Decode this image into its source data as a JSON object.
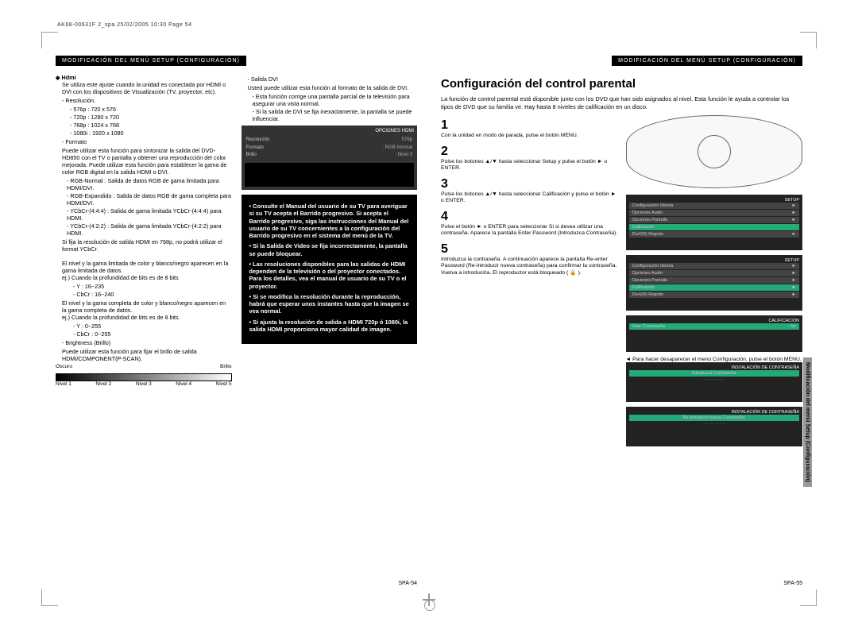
{
  "header": "AK68-00631F 2_spa  25/02/2005  10:30  Page 54",
  "section_bar": "Modificación del menú Setup (Configuración)",
  "left": {
    "hdmi": {
      "title": "Hdmi",
      "intro": "Se utiliza este ajuste cuando la unidad es conectada por HDMI o DVI con los dispositivos de Visualización (TV, proyector, etc).",
      "resolucion_label": "Resolución.",
      "res": [
        "576p : 720 x 576",
        "720p : 1280 x 720",
        "768p : 1024 x 768",
        "1080i : 1920 x 1080"
      ],
      "formato_label": "Formato",
      "formato_text": "Puede utilizar esta función para sintonizar la salida del DVD-HD850 con el TV o pantalla y obtener una reproducción del color mejorada. Puede utilizar esta función para establecer la gama de color RGB digital en la salida HDMI o DVI.",
      "rgb_normal": "RGB-Normal : Salida de datos RGB de gama limitada para HDMI/DVI.",
      "rgb_exp": "RGB-Expandido : Salida de datos RGB de gama completa para HDMI/DVI.",
      "yc444": "YCbCr-(4:4:4) : Salida de gama limitada YCbCr-(4:4:4) para HDMI.",
      "yc422": "YCbCr-(4:2:2) : Salida de gama limitada YCbCr-(4:2:2) para HDMI.",
      "note768": "Si fija la resolución de salida HDMI en 768p, no podrá utilizar el format YCbCr.",
      "gamma_lim": "El nivel y la gama limitada de color y blanco/negro aparecen en la gama limitada de datos.",
      "ej8a": "ej.) Cuando la profundidad de bits es de 8 bits",
      "y235": "Y : 16~235",
      "cb240": "CbCr : 16~240",
      "gamma_full": "El nivel y la gama completa de color y blanco/negro aparecen en la gama completa de datos.",
      "ej8b": "ej.) Cuando la profundidad de bits es de 8 bits.",
      "y255": "Y : 0~255",
      "cb255": "CbCr : 0~255",
      "brightness_label": "Brightness (Brillo)",
      "brightness_text": "Puede utilizar esta función para fijar el brillo de salida HDMI/COMPONENT(P-SCAN).",
      "oscuro": "Oscuro",
      "brillo": "Brillo",
      "levels": [
        "Nivel 1",
        "Nivel 2",
        "Nivel 3",
        "Nivel 4",
        "Nivel 5"
      ]
    },
    "dvi": {
      "label": "Salida DVI",
      "text": "Usted puede utilizar esta función al formato de la salida de DVI.",
      "b1": "Esta función corrige una pantalla parcial de la televisión para asegurar una vista normal.",
      "b2": "Si la salida de DVI se fija inexactamente, la pantalla se puede influenciar."
    },
    "osd": {
      "title": "OPCIONES HDMI",
      "rows": [
        [
          "Resolución",
          ": 576p"
        ],
        [
          "Formato",
          ": RGB-Normal"
        ],
        [
          "Brillo",
          ": Nivel 3"
        ]
      ]
    },
    "black_box": [
      "• Consulte el Manual del usuario de su TV para averiguar si su TV acepta el Barrido progresivo. Si acepta el Barrido progresivo, siga las instrucciones del Manual del usuario de su TV concernientes a la configuración del Barrido progresivo en el sistema del menú de la TV.",
      "• Si la Salida de Video se fija incorrectamente, la pantalla se puede bloquear.",
      "• Las resoluciones disponibles para las salidas de HDMI dependen de la televisión o del proyector conectados. Para los detalles, vea el manual de usuario de su TV o el proyector.",
      "• Si se modifica la resolución durante la reproducción, habrá que esperar unos instantes hasta que la imagen se vea normal.",
      "• Si ajusta la resolución de salida a HDMI 720p ó 1080i, la salida HDMI proporciona mayor calidad de imagen."
    ],
    "page_num": "SPA-54"
  },
  "right": {
    "title": "Configuración del control parental",
    "intro": "La función de control parental está disponible junto con los DVD que han sido asignados al nivel. Esta función le ayuda a controlar los tipos de DVD que su familia ve. Hay hasta 8 niveles de calificación en un disco.",
    "steps": {
      "s1": "Con la unidad en modo de parada, pulse el botón MENU.",
      "s2": "Pulse los botones ▲/▼ hasta seleccionar Setup y pulse el botón ► o ENTER.",
      "s3": "Pulse los botones ▲/▼ hasta seleccionar Calificación y pulse el botón ► o ENTER.",
      "s4": "Pulse el botón ► o ENTER para seleccionar Si si desea utilizar una contraseña. Aparece la pantalla Enter Password (Introduzca Contraseña).",
      "s5": "Introduzca la contraseña. A continuación aparece la pantalla Re-enter Password (Re-introducir nueva contraseña) para confirmar la contraseña. Vuelva a introducirla. El reproductor está bloqueado ( 🔒 )."
    },
    "osd2_rows": [
      "Configuración Idioma",
      "Opciones Audio",
      "Opciones Pantalla",
      "Calificación",
      "DivX(R) Registo"
    ],
    "osd3_rows": [
      "Configuración Idioma",
      "Opciones Audio",
      "Opciones Pantalla",
      "Calificación",
      "DivX(R) Registo"
    ],
    "osd4_title": "CALIFICACIÓN",
    "osd4_row": [
      "Usar Contraseña",
      ": No"
    ],
    "osd5_title": "INSTALACIÓN DE CONTRASEÑA",
    "osd5_row": "Introduzca Contraseña",
    "osd6_title": "INSTALACIÓN DE CONTRASEÑA",
    "osd6_row": "Re-Introducir nueva Contraseña",
    "close": "◄ Para hacer desaparecer el menú Configuración, pulse el botón MENU.",
    "side_tab": "Modificación del menú Setup (Configuración)",
    "page_num": "SPA-55"
  }
}
